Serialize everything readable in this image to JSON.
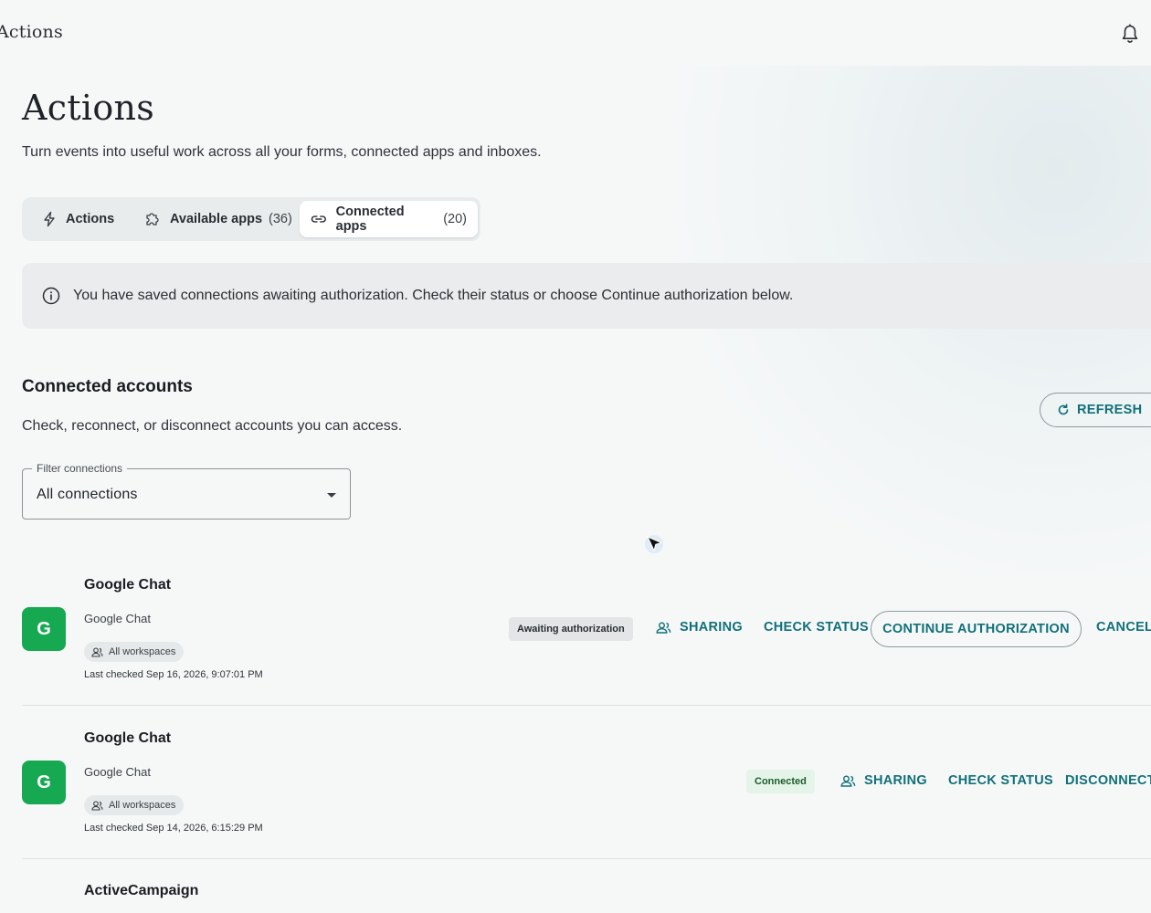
{
  "topbar": {
    "title": "Actions",
    "bell_icon": "bell-icon"
  },
  "header": {
    "title": "Actions",
    "subtitle": "Turn events into useful work across all your forms, connected apps and inboxes."
  },
  "tabs": [
    {
      "label": "Actions",
      "count": "",
      "icon": "lightning-icon",
      "active": false
    },
    {
      "label": "Available apps",
      "count": "(36)",
      "icon": "puzzle-icon",
      "active": false
    },
    {
      "label": "Connected apps",
      "count": "(20)",
      "icon": "link-icon",
      "active": true
    }
  ],
  "banner": {
    "icon": "info-icon",
    "text": "You have saved connections awaiting authorization. Check their status or choose Continue authorization below."
  },
  "section": {
    "title": "Connected accounts",
    "subtitle": "Check, reconnect, or disconnect accounts you can access.",
    "refresh_label": "REFRESH"
  },
  "filter": {
    "label": "Filter connections",
    "value": "All connections"
  },
  "connections": [
    {
      "logo_letter": "G",
      "name": "Google Chat",
      "provider": "Google Chat",
      "scope": "All workspaces",
      "last_checked": "Last checked Sep 16, 2026, 9:07:01 PM",
      "status": "Awaiting authorization",
      "actions": {
        "sharing": "SHARING",
        "check_status": "CHECK STATUS",
        "continue": "CONTINUE AUTHORIZATION",
        "cancel": "CANCEL"
      }
    },
    {
      "logo_letter": "G",
      "name": "Google Chat",
      "provider": "Google Chat",
      "scope": "All workspaces",
      "last_checked": "Last checked Sep 14, 2026, 6:15:29 PM",
      "status": "Connected",
      "actions": {
        "sharing": "SHARING",
        "check_status": "CHECK STATUS",
        "disconnect": "DISCONNECT"
      }
    },
    {
      "name": "ActiveCampaign"
    }
  ],
  "colors": {
    "accent": "#11707a",
    "google_chat_green": "#16a951",
    "connected_badge_bg": "#e4f4e8"
  }
}
